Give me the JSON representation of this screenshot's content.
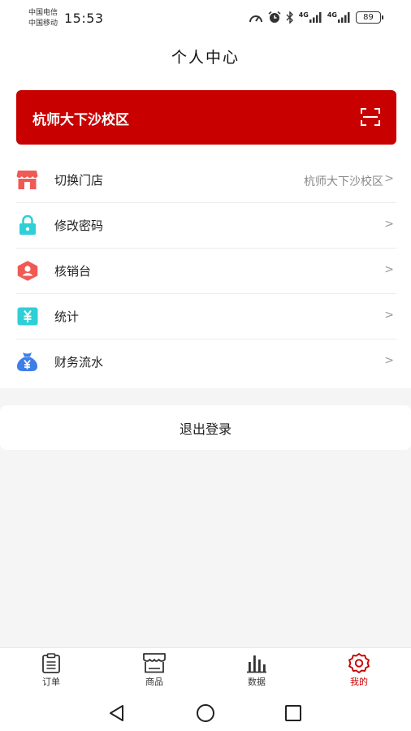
{
  "status_bar": {
    "carrier_1": "中国电信",
    "carrier_2": "中国移动",
    "time": "15:53",
    "network_1": "4G",
    "network_2": "4G",
    "battery": "89",
    "icons": [
      "speed-icon",
      "alarm-icon",
      "bluetooth-icon",
      "signal-icon",
      "signal-icon",
      "battery-icon"
    ]
  },
  "header": {
    "title": "个人中心"
  },
  "store_banner": {
    "store_name": "杭师大下沙校区",
    "icon": "scan-icon",
    "color": "#c80000"
  },
  "menu": {
    "items": [
      {
        "label": "切换门店",
        "value": "杭师大下沙校区",
        "icon": "store-icon",
        "icon_color": "#ef5a55"
      },
      {
        "label": "修改密码",
        "value": "",
        "icon": "lock-icon",
        "icon_color": "#2ecfd6"
      },
      {
        "label": "核销台",
        "value": "",
        "icon": "user-hexagon-icon",
        "icon_color": "#ef5a55"
      },
      {
        "label": "统计",
        "value": "",
        "icon": "yen-doc-icon",
        "icon_color": "#2ecfd6"
      },
      {
        "label": "财务流水",
        "value": "",
        "icon": "money-bag-icon",
        "icon_color": "#3f7ee8"
      }
    ],
    "chevron": ">"
  },
  "logout": {
    "label": "退出登录"
  },
  "tab_bar": {
    "active_color": "#c80000",
    "tabs": [
      {
        "label": "订单",
        "icon": "clipboard-icon",
        "active": false
      },
      {
        "label": "商品",
        "icon": "shop-icon",
        "active": false
      },
      {
        "label": "数据",
        "icon": "bar-chart-icon",
        "active": false
      },
      {
        "label": "我的",
        "icon": "gear-icon",
        "active": true
      }
    ]
  },
  "system_nav": {
    "buttons": [
      "back-icon",
      "home-icon",
      "recents-icon"
    ]
  }
}
